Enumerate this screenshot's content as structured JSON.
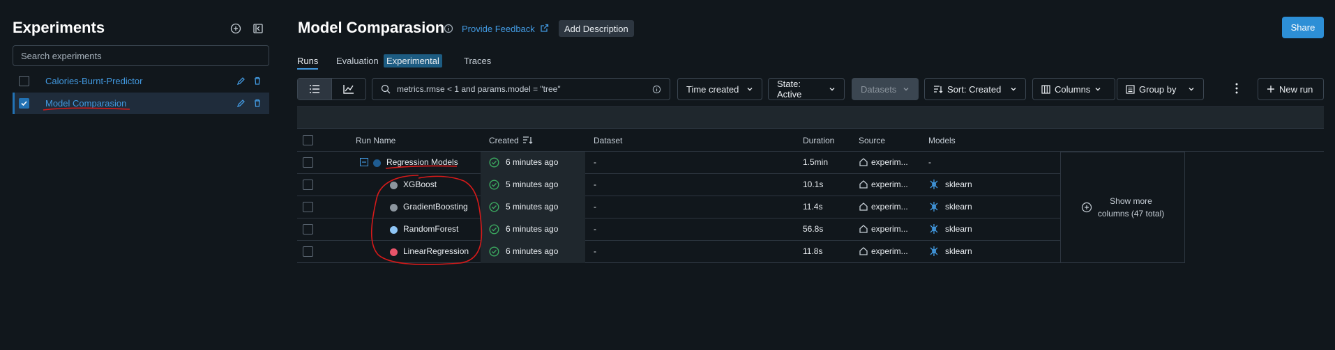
{
  "sidebar": {
    "title": "Experiments",
    "search_placeholder": "Search experiments",
    "experiments": [
      {
        "label": "Calories-Burnt-Predictor",
        "checked": false
      },
      {
        "label": "Model Comparasion",
        "checked": true
      }
    ]
  },
  "header": {
    "title": "Model Comparasion",
    "feedback_label": "Provide Feedback",
    "add_description_label": "Add Description",
    "share_label": "Share"
  },
  "tabs": {
    "runs": "Runs",
    "evaluation": "Evaluation",
    "evaluation_badge": "Experimental",
    "traces": "Traces"
  },
  "toolbar": {
    "search_value": "metrics.rmse < 1 and params.model = \"tree\"",
    "time_created": "Time created",
    "state": "State: Active",
    "datasets": "Datasets",
    "sort": "Sort: Created",
    "columns": "Columns",
    "group_by": "Group by",
    "new_run": "New run"
  },
  "table": {
    "headers": {
      "run_name": "Run Name",
      "created": "Created",
      "dataset": "Dataset",
      "duration": "Duration",
      "source": "Source",
      "models": "Models"
    },
    "rows": [
      {
        "name": "Regression Models",
        "created": "6 minutes ago",
        "dataset": "-",
        "duration": "1.5min",
        "source": "experim...",
        "models": "-",
        "dot_color": "#1f5c91",
        "parent": true
      },
      {
        "name": "XGBoost",
        "created": "5 minutes ago",
        "dataset": "-",
        "duration": "10.1s",
        "source": "experim...",
        "models": "sklearn",
        "dot_color": "#8c959e",
        "parent": false
      },
      {
        "name": "GradientBoosting",
        "created": "5 minutes ago",
        "dataset": "-",
        "duration": "11.4s",
        "source": "experim...",
        "models": "sklearn",
        "dot_color": "#8c959e",
        "parent": false
      },
      {
        "name": "RandomForest",
        "created": "6 minutes ago",
        "dataset": "-",
        "duration": "56.8s",
        "source": "experim...",
        "models": "sklearn",
        "dot_color": "#8ec5f5",
        "parent": false
      },
      {
        "name": "LinearRegression",
        "created": "6 minutes ago",
        "dataset": "-",
        "duration": "11.8s",
        "source": "experim...",
        "models": "sklearn",
        "dot_color": "#e8546a",
        "parent": false
      }
    ],
    "show_more_line1": "Show more",
    "show_more_line2": "columns (47 total)"
  },
  "colors": {
    "accent": "#4299e0",
    "primary_button": "#2272b4",
    "annotation": "#d61a1a"
  }
}
